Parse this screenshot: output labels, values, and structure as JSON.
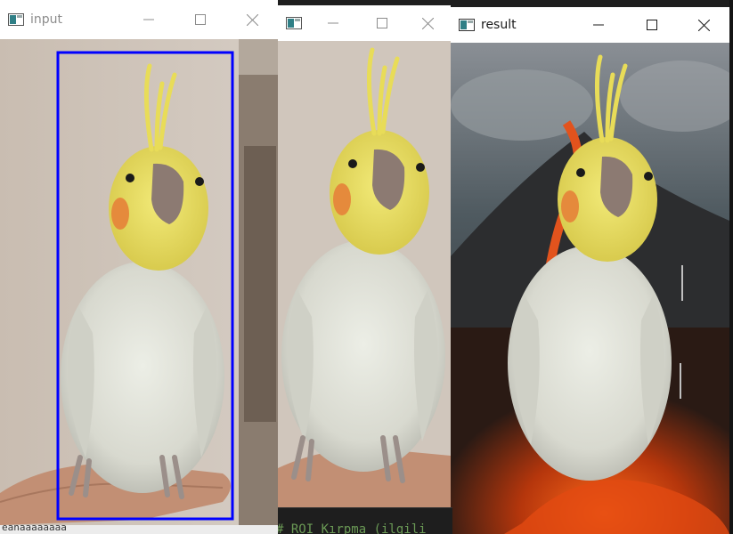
{
  "windows": [
    {
      "id": "input",
      "title": "input"
    },
    {
      "id": "middle",
      "title": ""
    },
    {
      "id": "result",
      "title": "result"
    }
  ],
  "controls": {
    "minimize": "minimize-icon",
    "maximize": "maximize-icon",
    "close": "close-icon"
  },
  "editor": {
    "comment_text": "# ROI Kırpma (ilgili"
  },
  "terminal": {
    "text": "eanaaaaaaaa"
  },
  "colors": {
    "selection_box": "#0000ff",
    "titlebar": "#ffffff",
    "editor_bg": "#1e1e1e",
    "comment": "#6a9955"
  }
}
